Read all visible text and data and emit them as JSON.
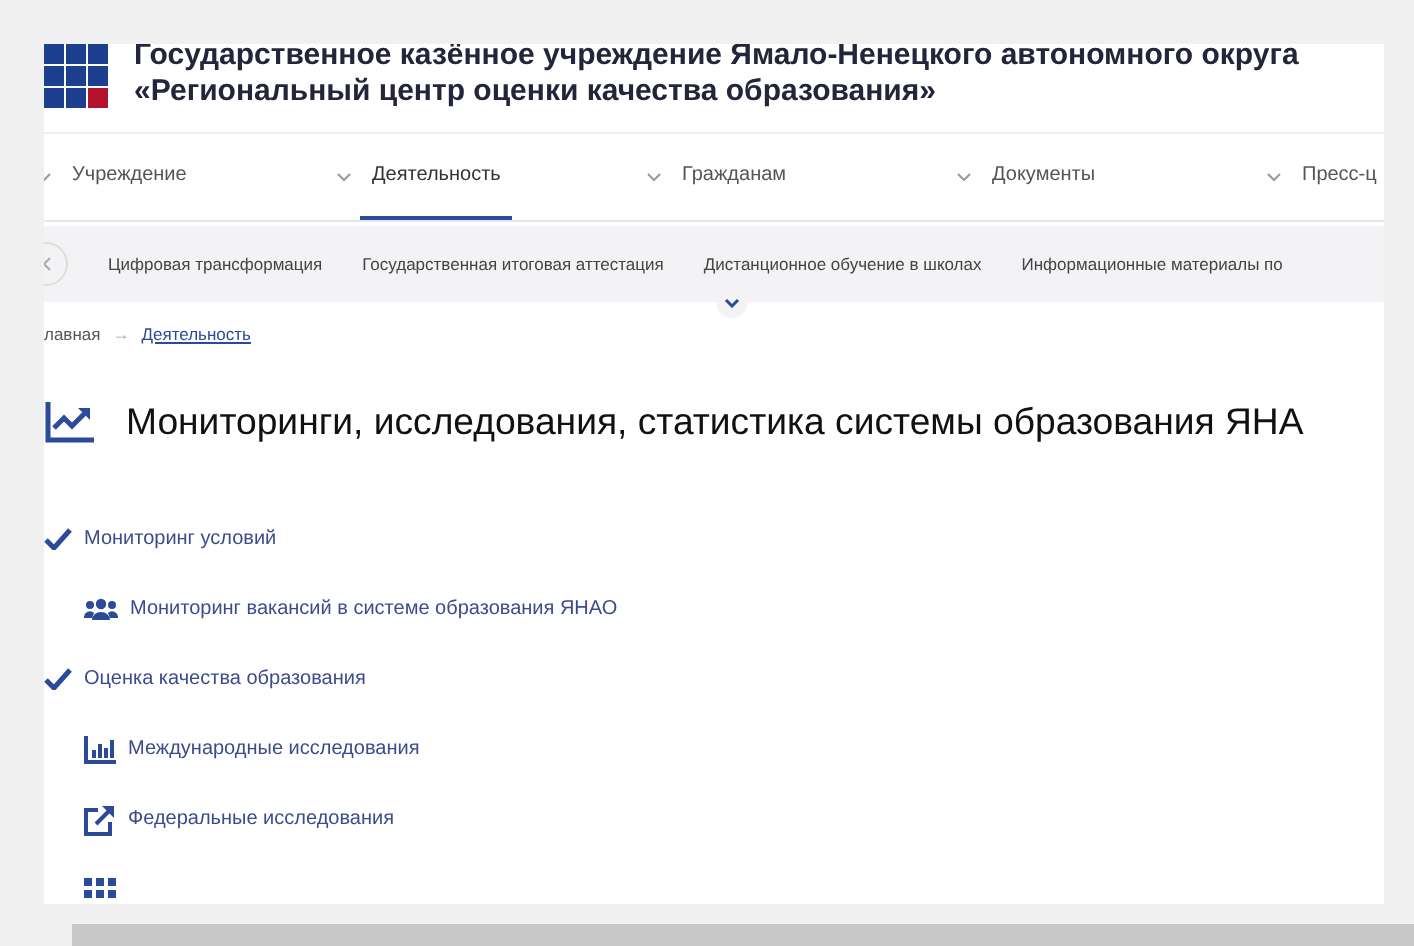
{
  "header": {
    "title_line_1": "Государственное казённое учреждение Ямало-Ненецкого автономного округа",
    "title_line_2": "«Региональный центр оценки качества образования»"
  },
  "nav": [
    {
      "label": "Учреждение",
      "selected": false
    },
    {
      "label": "Деятельность",
      "selected": true
    },
    {
      "label": "Гражданам",
      "selected": false
    },
    {
      "label": "Документы",
      "selected": false
    },
    {
      "label": "Пресс-ц",
      "selected": false
    }
  ],
  "subnav": [
    "Цифровая трансформация",
    "Государственная итоговая аттестация",
    "Дистанционное обучение в школах",
    "Информационные материалы по"
  ],
  "breadcrumbs": [
    {
      "label": "лавная",
      "kind": "plain"
    },
    {
      "label": "→",
      "kind": "separator"
    },
    {
      "label": "Деятельность",
      "kind": "link"
    }
  ],
  "heading": "Мониторинги, исследования, статистика системы образования ЯНА",
  "items": [
    {
      "kind": "check",
      "label": "Мониторинг условий"
    },
    {
      "kind": "people",
      "label": "Мониторинг вакансий в системе образования ЯНАО"
    },
    {
      "kind": "check",
      "label": "Оценка качества образования"
    },
    {
      "kind": "bars",
      "label": "Международные исследования"
    },
    {
      "kind": "external",
      "label": "Федеральные исследования"
    },
    {
      "kind": "grid"
    }
  ]
}
